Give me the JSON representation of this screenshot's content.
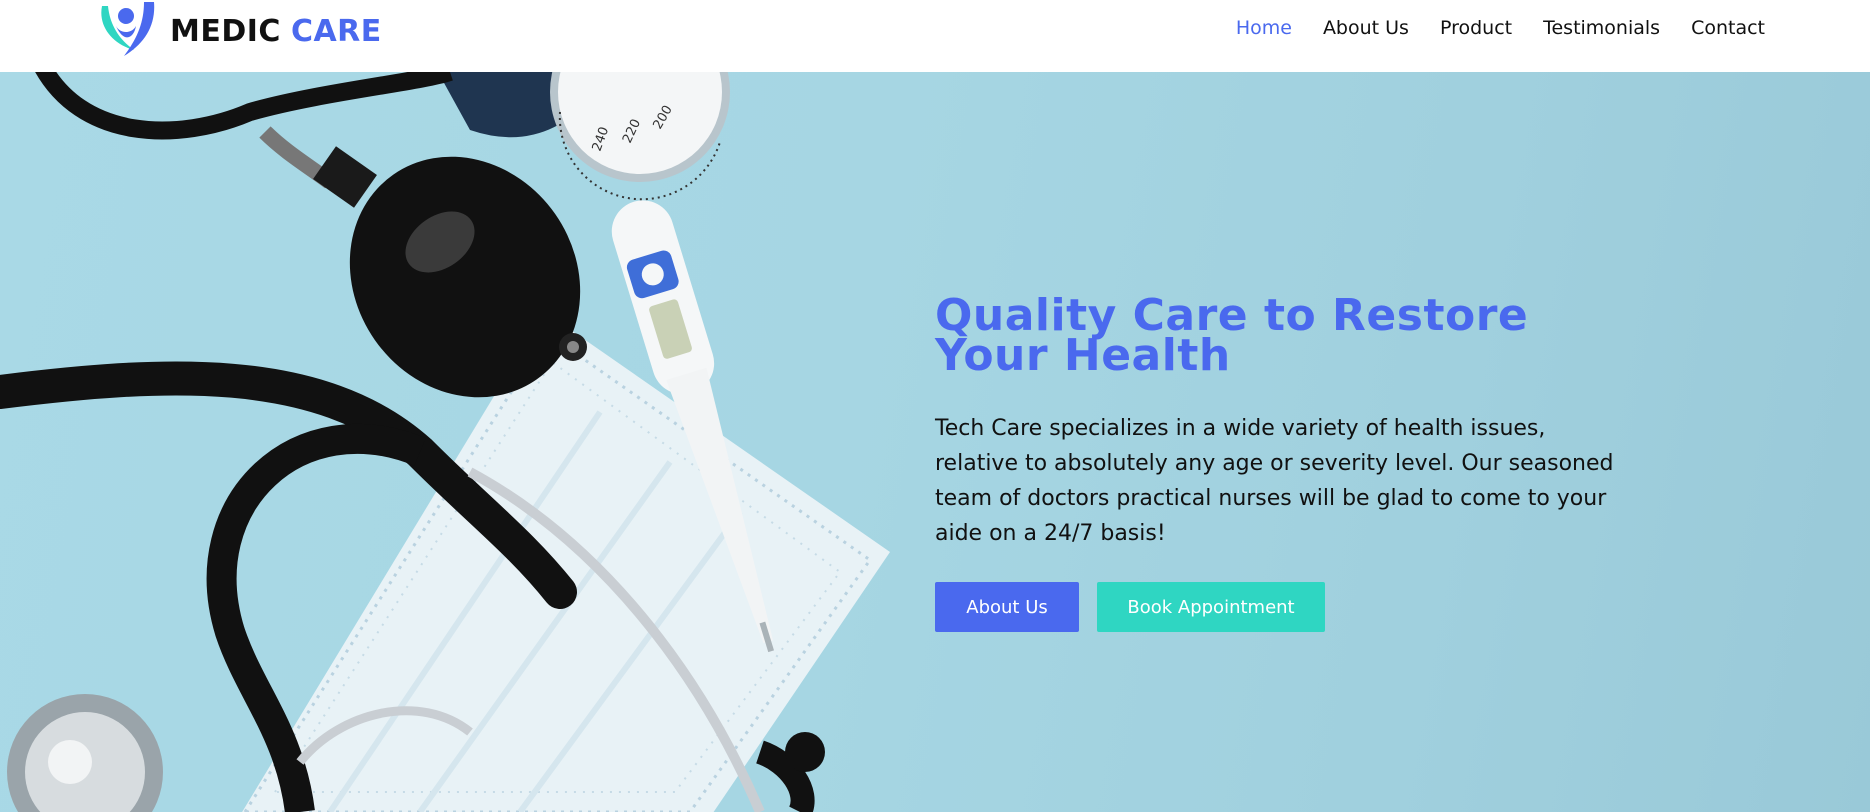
{
  "brand": {
    "word1": "MEDIC",
    "word2": "CARE"
  },
  "nav": {
    "items": [
      {
        "label": "Home",
        "active": true
      },
      {
        "label": "About Us",
        "active": false
      },
      {
        "label": "Product",
        "active": false
      },
      {
        "label": "Testimonials",
        "active": false
      },
      {
        "label": "Contact",
        "active": false
      }
    ]
  },
  "hero": {
    "title": "Quality Care to Restore Your Health",
    "description": "Tech Care specializes in a wide variety of health issues, relative to absolutely any age or severity level. Our seasoned team of doctors practical nurses will be glad to come to your aide on a 24/7 basis!",
    "primary_button": "About Us",
    "secondary_button": "Book Appointment",
    "gauge_labels": [
      "200",
      "220",
      "240"
    ]
  },
  "colors": {
    "accent": "#4a69ee",
    "teal": "#2fd6c2",
    "hero_bg": "#a6d6e3"
  },
  "icons": {
    "logo": "person-leaf-logo-icon"
  }
}
